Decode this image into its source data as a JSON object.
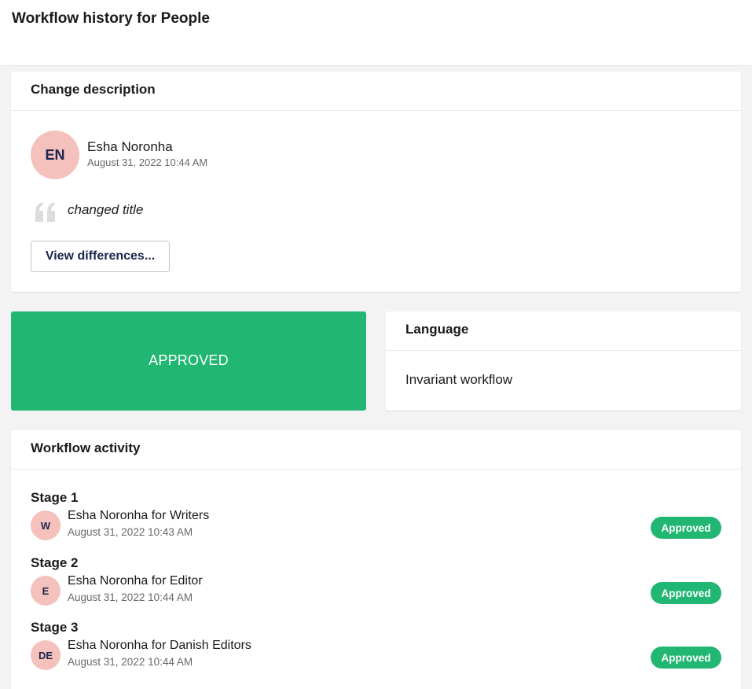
{
  "page": {
    "title": "Workflow history for People"
  },
  "change_description": {
    "header": "Change description",
    "author": {
      "initials": "EN",
      "name": "Esha Noronha",
      "date": "August 31, 2022 10:44 AM"
    },
    "comment": "changed title",
    "view_button": "View differences..."
  },
  "status": {
    "label": "APPROVED",
    "color": "#21b773"
  },
  "language": {
    "header": "Language",
    "value": "Invariant workflow"
  },
  "activity": {
    "header": "Workflow activity",
    "stages": [
      {
        "title": "Stage 1",
        "initials": "W",
        "name": "Esha Noronha for Writers",
        "date": "August 31, 2022 10:43 AM",
        "status": "Approved"
      },
      {
        "title": "Stage 2",
        "initials": "E",
        "name": "Esha Noronha for Editor",
        "date": "August 31, 2022 10:44 AM",
        "status": "Approved"
      },
      {
        "title": "Stage 3",
        "initials": "DE",
        "name": "Esha Noronha for Danish Editors",
        "date": "August 31, 2022 10:44 AM",
        "status": "Approved"
      }
    ]
  },
  "icons": {
    "quote": "quote-icon"
  },
  "colors": {
    "accent": "#21b773",
    "avatar": "#f5c1bc",
    "text": "#1b264f"
  }
}
